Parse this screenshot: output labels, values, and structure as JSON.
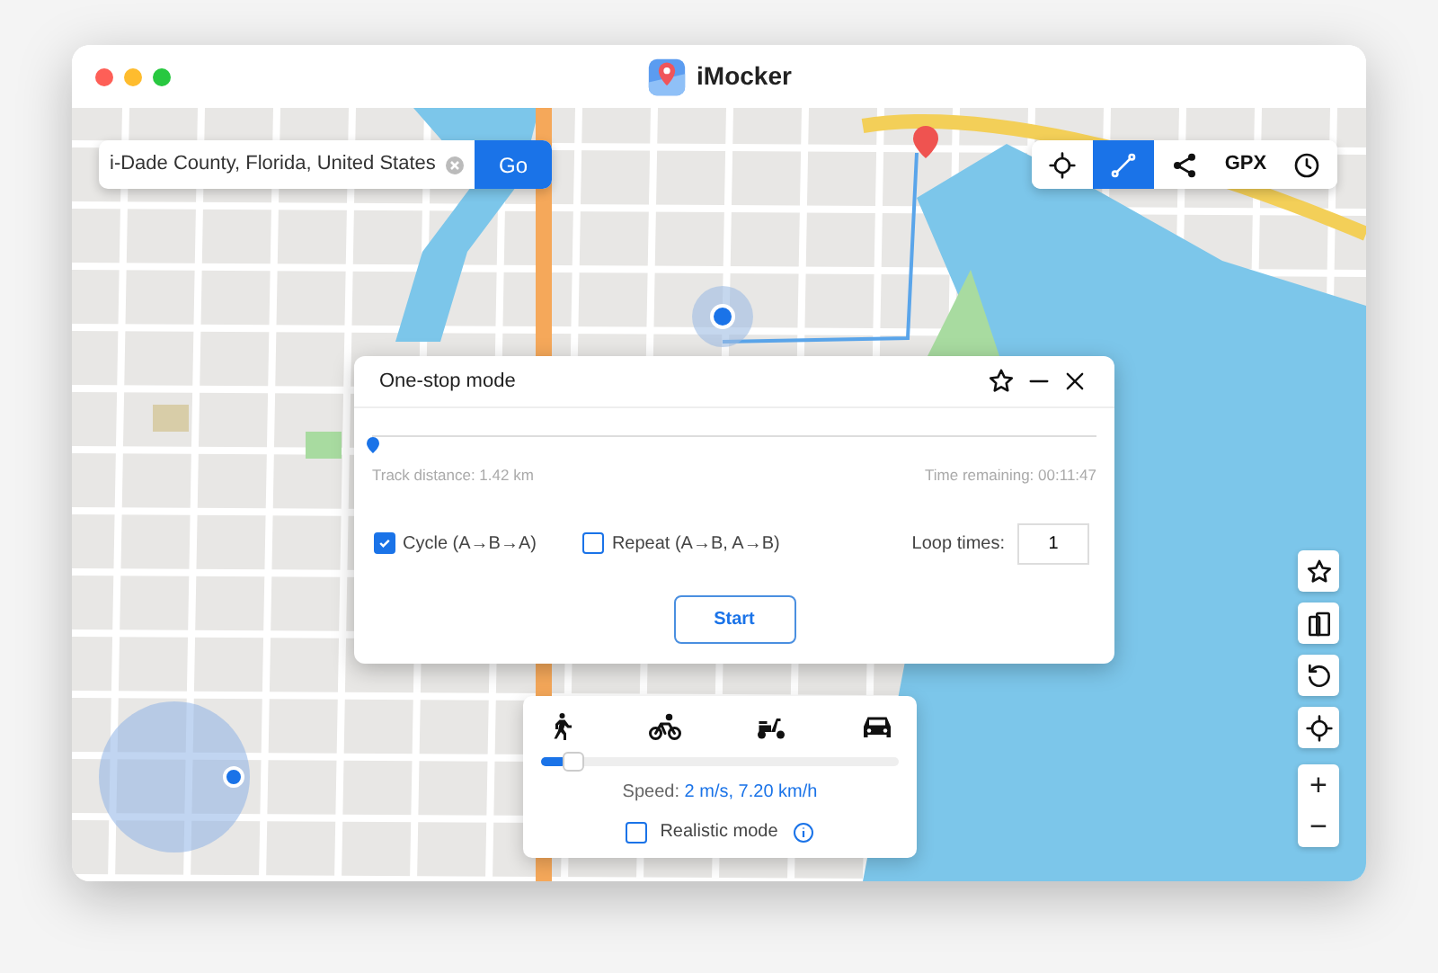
{
  "window": {
    "title": "iMocker"
  },
  "search": {
    "value": "i-Dade County, Florida, United States",
    "button": "Go"
  },
  "toolbar": [
    {
      "kind": "locate",
      "selected": false
    },
    {
      "kind": "route",
      "selected": true
    },
    {
      "kind": "share",
      "selected": false
    },
    {
      "kind": "text",
      "label": "GPX",
      "selected": false
    },
    {
      "kind": "history",
      "selected": false
    }
  ],
  "dialog": {
    "title": "One-stop mode",
    "progress": {
      "level": 0
    },
    "track_distance": "Track distance: 1.42 km",
    "time_remaining": "Time remaining: 00:11:47",
    "options": [
      {
        "label": "Cycle (A→B→A)",
        "checked": true
      },
      {
        "label": "Repeat (A→B, A→B)",
        "checked": false
      }
    ],
    "loop_label": "Loop times:",
    "loop_value": "1",
    "start_button": "Start"
  },
  "speed_panel": {
    "modes": [
      {
        "kind": "walk"
      },
      {
        "kind": "bike"
      },
      {
        "kind": "scooter"
      },
      {
        "kind": "car"
      }
    ],
    "speed": {
      "level": 0.07
    },
    "speed_label": "Speed:",
    "speed_value": "2 m/s, 7.20 km/h",
    "realistic_mode": {
      "label": "Realistic mode",
      "checked": false
    }
  },
  "side_buttons": [
    {
      "kind": "favorite"
    },
    {
      "kind": "device"
    },
    {
      "kind": "reset"
    },
    {
      "kind": "locate"
    }
  ],
  "zoom": {
    "in": "+",
    "out": "−"
  }
}
